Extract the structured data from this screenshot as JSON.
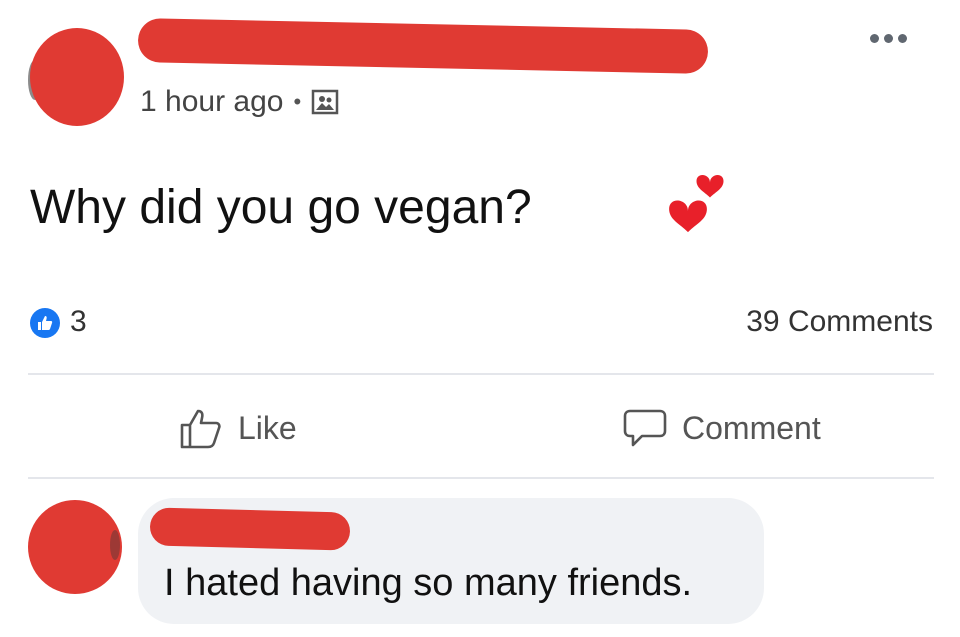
{
  "post": {
    "author_name": "",
    "timestamp": "1 hour ago",
    "separator": "•",
    "audience_icon": "photo-icon",
    "text": "Why did you go vegan?",
    "emoji": "two-hearts-icon"
  },
  "reactions": {
    "like_count": "3",
    "comments_count": "39 Comments"
  },
  "actions": {
    "like_label": "Like",
    "comment_label": "Comment"
  },
  "comment": {
    "author_name": "",
    "text": "I hated having so many friends."
  },
  "colors": {
    "redaction": "#e03a33",
    "like_blue": "#1877f2",
    "bubble_bg": "#f0f2f5",
    "divider": "#e4e6eb"
  }
}
